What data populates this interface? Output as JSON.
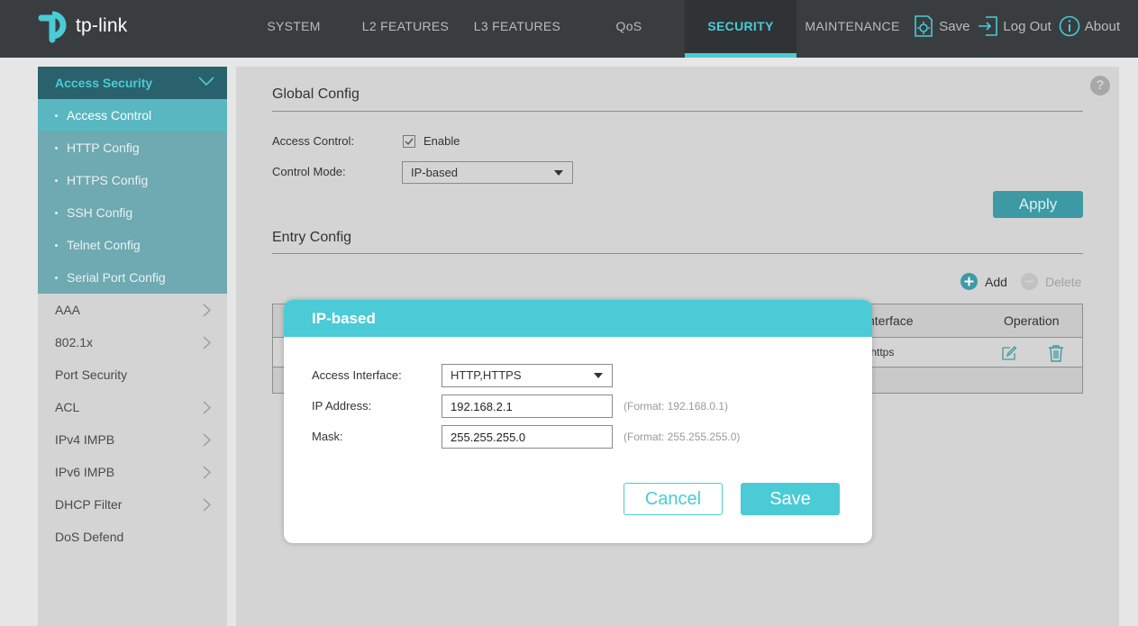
{
  "brand": {
    "logo_text": "tp-link"
  },
  "nav": {
    "items": [
      {
        "label": "SYSTEM"
      },
      {
        "label": "L2 FEATURES"
      },
      {
        "label": "L3 FEATURES"
      },
      {
        "label": "QoS"
      },
      {
        "label": "SECURITY",
        "active": true
      },
      {
        "label": "MAINTENANCE"
      }
    ],
    "actions": {
      "save": "Save",
      "logout": "Log Out",
      "about": "About"
    }
  },
  "sidebar": {
    "group": "Access Security",
    "subitems": [
      {
        "label": "Access Control",
        "active": true
      },
      {
        "label": "HTTP Config"
      },
      {
        "label": "HTTPS Config"
      },
      {
        "label": "SSH Config"
      },
      {
        "label": "Telnet Config"
      },
      {
        "label": "Serial Port Config"
      }
    ],
    "items": [
      {
        "label": "AAA",
        "has_chevron": true
      },
      {
        "label": "802.1x",
        "has_chevron": true
      },
      {
        "label": "Port Security",
        "has_chevron": false
      },
      {
        "label": "ACL",
        "has_chevron": true
      },
      {
        "label": "IPv4 IMPB",
        "has_chevron": true
      },
      {
        "label": "IPv6 IMPB",
        "has_chevron": true
      },
      {
        "label": "DHCP Filter",
        "has_chevron": true
      },
      {
        "label": "DoS Defend",
        "has_chevron": false
      }
    ]
  },
  "main": {
    "help": "?",
    "global_config": {
      "title": "Global Config",
      "access_control_label": "Access Control:",
      "enable_label": "Enable",
      "enable_checked": true,
      "control_mode_label": "Control Mode:",
      "control_mode_value": "IP-based",
      "apply_label": "Apply"
    },
    "entry_config": {
      "title": "Entry Config",
      "add_label": "Add",
      "delete_label": "Delete",
      "columns": {
        "interface": "nterface",
        "operation": "Operation"
      },
      "rows": [
        {
          "interface": ",https"
        }
      ]
    }
  },
  "modal": {
    "title": "IP-based",
    "access_interface_label": "Access Interface:",
    "access_interface_value": "HTTP,HTTPS",
    "ip_label": "IP Address:",
    "ip_value": "192.168.2.1",
    "ip_hint": "(Format: 192.168.0.1)",
    "mask_label": "Mask:",
    "mask_value": "255.255.255.0",
    "mask_hint": "(Format: 255.255.255.0)",
    "cancel_label": "Cancel",
    "save_label": "Save"
  },
  "colors": {
    "accent": "#4acbd6",
    "topbar": "#393d40",
    "sidebar_head": "#29626c",
    "sidebar_sub": "#6fa9b1",
    "panel": "#d4d4d4"
  }
}
